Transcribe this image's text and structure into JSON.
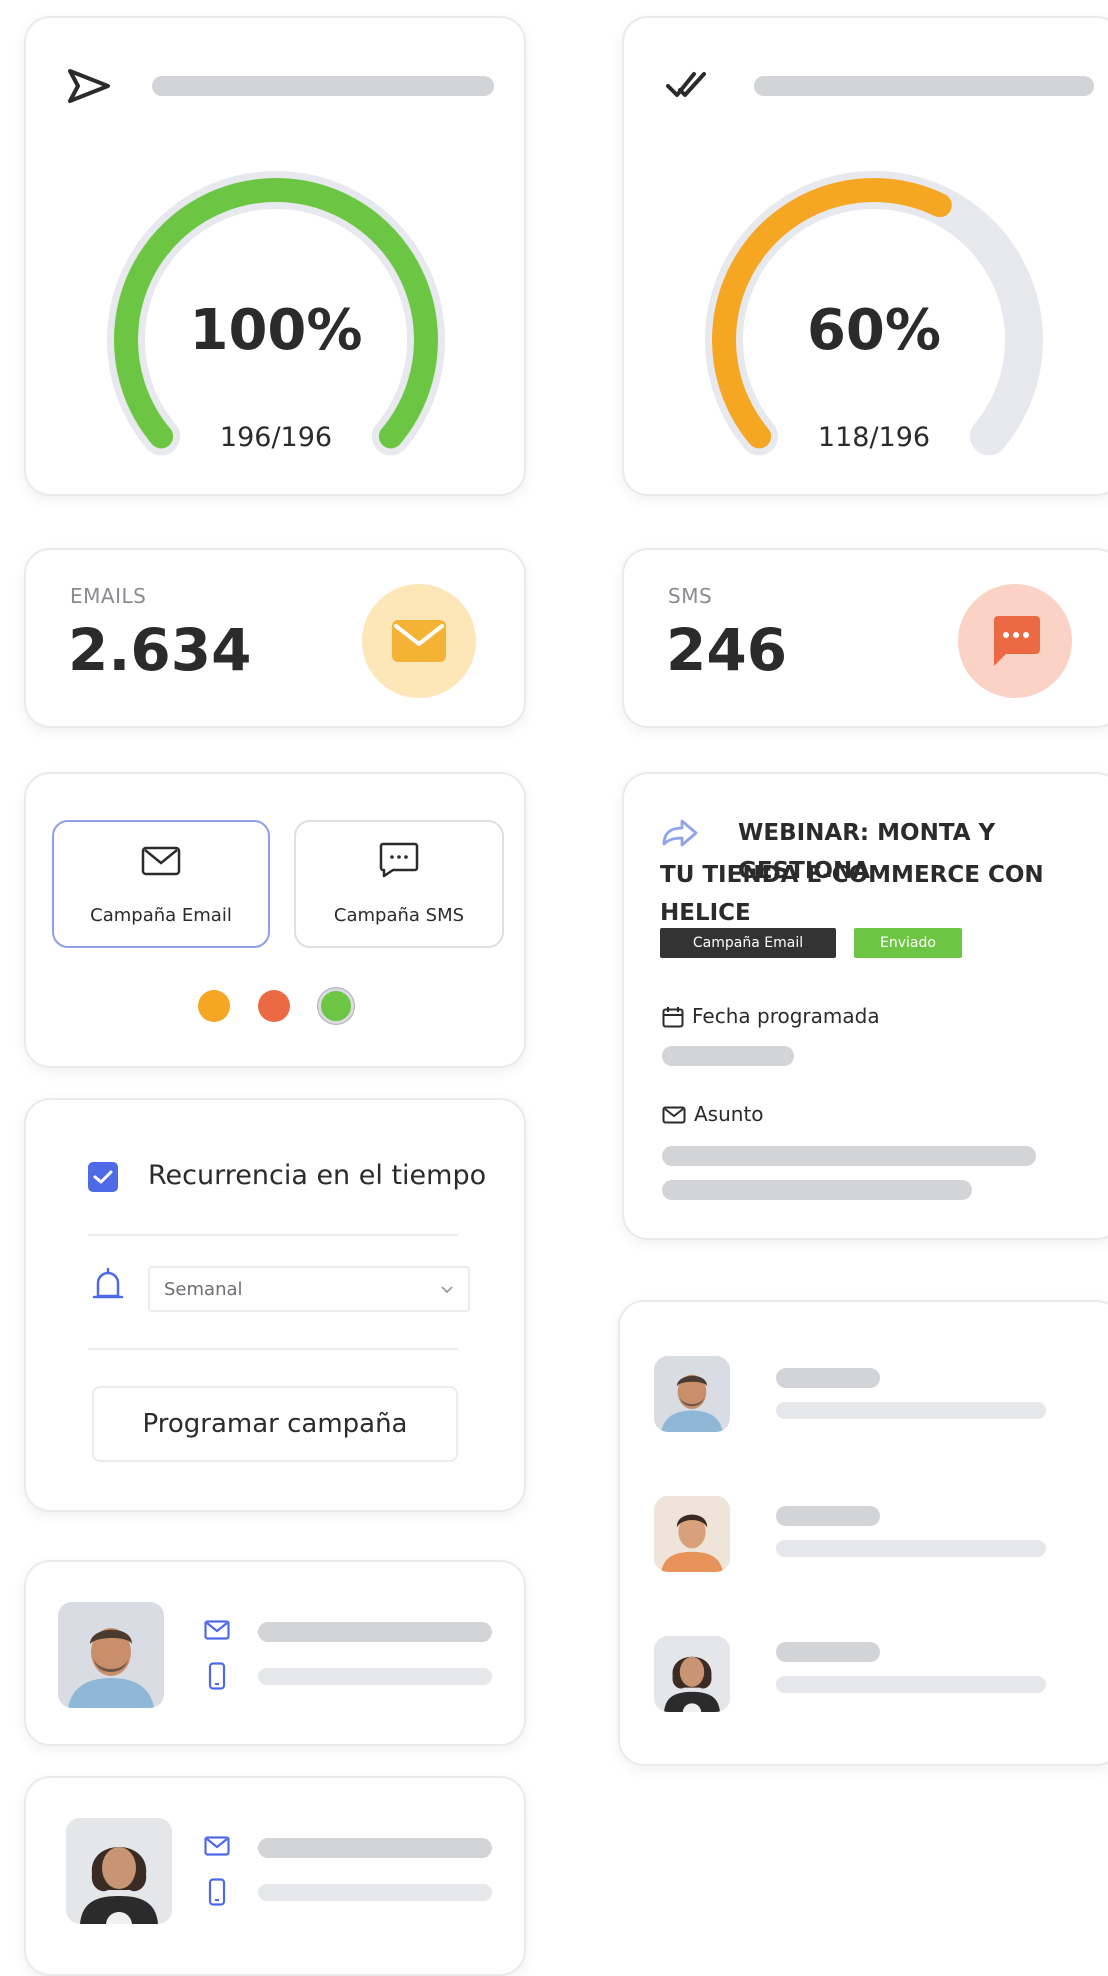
{
  "gauge_sent": {
    "icon": "send-icon",
    "percent_label": "100%",
    "ratio_label": "196/196",
    "fraction": 1.0,
    "color": "#6cc644"
  },
  "gauge_delivered": {
    "icon": "double-check-icon",
    "percent_label": "60%",
    "ratio_label": "118/196",
    "fraction": 0.6,
    "color": "#f5a623"
  },
  "stat_emails": {
    "label": "EMAILS",
    "value": "2.634",
    "icon": "envelope-icon",
    "color": "#f5b335",
    "bg": "#fde7b9"
  },
  "stat_sms": {
    "label": "SMS",
    "value": "246",
    "icon": "chat-bubble-icon",
    "color": "#ec6a43",
    "bg": "#fad3c6"
  },
  "campaign_type": {
    "email_label": "Campaña Email",
    "sms_label": "Campaña SMS",
    "selected": "email",
    "dot_colors": [
      "#f5a623",
      "#ec6a43",
      "#6cc644"
    ]
  },
  "recurrence": {
    "checkbox_label": "Recurrencia en el tiempo",
    "checked": true,
    "frequency": "Semanal",
    "submit_label": "Programar campaña"
  },
  "webinar": {
    "title_line1": "WEBINAR: MONTA Y GESTIONA",
    "title_line2": "TU TIENDA E-COMMERCE CON HELICE",
    "type_badge": "Campaña Email",
    "status_badge": "Enviado",
    "date_label": "Fecha programada",
    "subject_label": "Asunto"
  },
  "colors": {
    "accent": "#4f6ae6",
    "dark_badge": "#333333",
    "green": "#6cc644"
  }
}
